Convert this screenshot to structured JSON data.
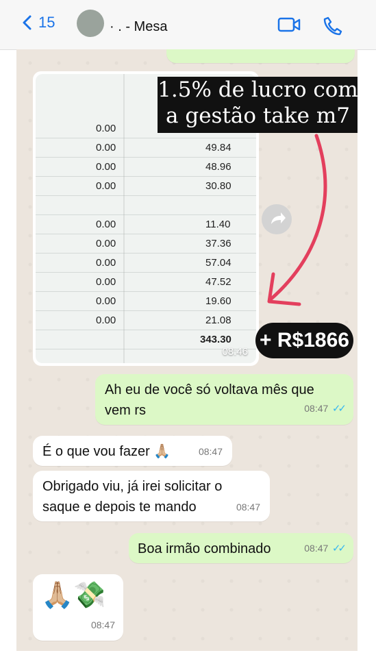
{
  "header": {
    "back_count": "15",
    "contact_name": "·  . - Mesa"
  },
  "photo": {
    "time": "08:46",
    "overlay_text": "1.5% de lucro com a gestão take m7",
    "badge_text": "+ R$1866",
    "rows": [
      {
        "left": "0.00",
        "right": ""
      },
      {
        "left": "0.00",
        "right": "49.84"
      },
      {
        "left": "0.00",
        "right": "48.96"
      },
      {
        "left": "0.00",
        "right": "30.80"
      },
      {
        "left": "",
        "right": ""
      },
      {
        "left": "0.00",
        "right": "11.40"
      },
      {
        "left": "0.00",
        "right": "37.36"
      },
      {
        "left": "0.00",
        "right": "57.04"
      },
      {
        "left": "0.00",
        "right": "47.52"
      },
      {
        "left": "0.00",
        "right": "19.60"
      },
      {
        "left": "0.00",
        "right": "21.08"
      },
      {
        "left": "",
        "right": "343.30"
      }
    ]
  },
  "messages": [
    {
      "text": "Ah eu de você só voltava mês que vem rs",
      "time": "08:47"
    },
    {
      "text": "É o que vou fazer 🙏🏼",
      "time": "08:47"
    },
    {
      "text": "Obrigado viu, já irei solicitar o saque e depois te mando",
      "time": "08:47"
    },
    {
      "text": "Boa irmão combinado",
      "time": "08:47"
    },
    {
      "text": "🙏🏼💸",
      "time": "08:47"
    }
  ],
  "colors": {
    "accent": "#1a73e8",
    "outgoing_bubble": "#dcf8c6",
    "incoming_bubble": "#ffffff",
    "arrow": "#e33f5d"
  }
}
